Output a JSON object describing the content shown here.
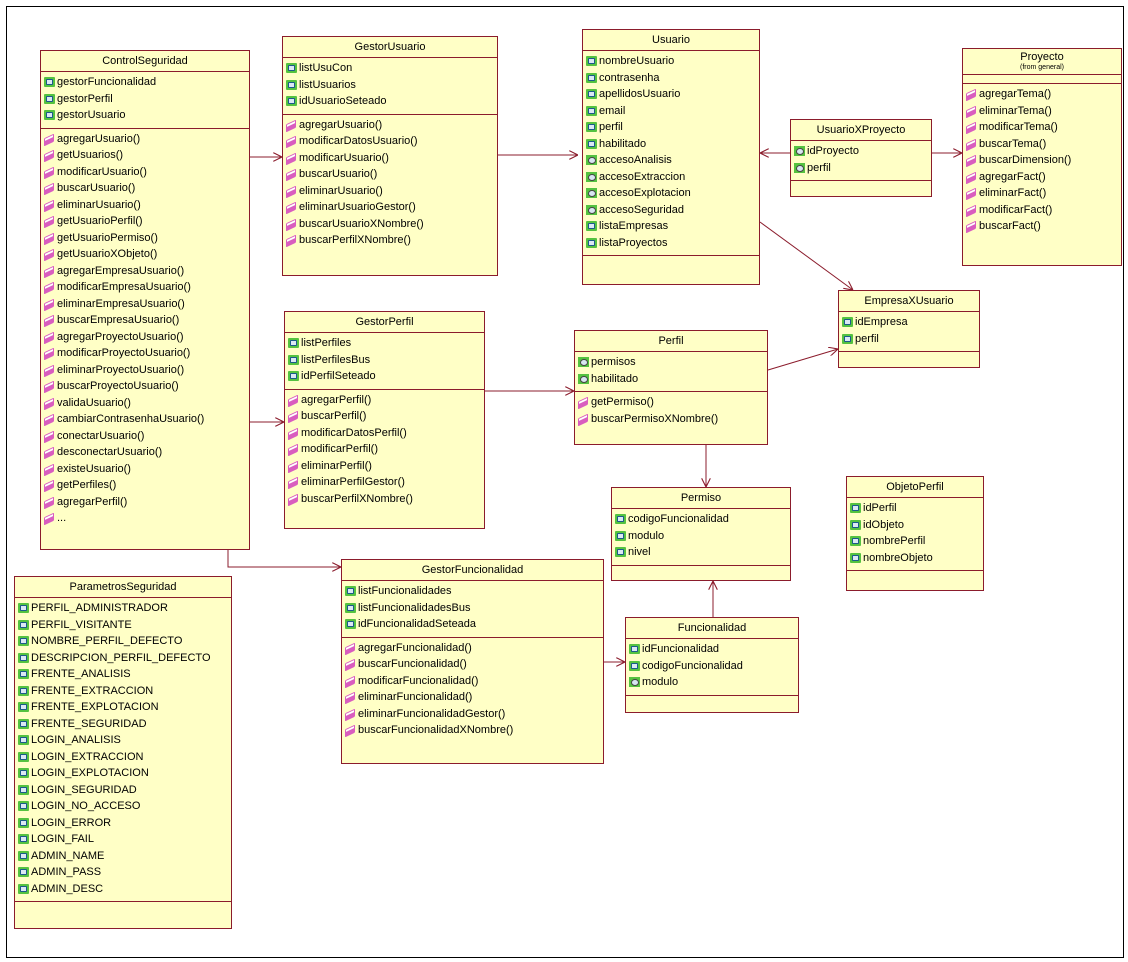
{
  "colors": {
    "class_fill": "#ffffc6",
    "class_border": "#8b1c2c",
    "attr_icon": "#55c240",
    "op_icon": "#d95dbf",
    "link": "#8b1c2c"
  },
  "classes": {
    "control_seguridad": {
      "name": "ControlSeguridad",
      "attributes": [
        "gestorFuncionalidad",
        "gestorPerfil",
        "gestorUsuario"
      ],
      "operations": [
        "agregarUsuario()",
        "getUsuarios()",
        "modificarUsuario()",
        "buscarUsuario()",
        "eliminarUsuario()",
        "getUsuarioPerfil()",
        "getUsuarioPermiso()",
        "getUsuarioXObjeto()",
        "agregarEmpresaUsuario()",
        "modificarEmpresaUsuario()",
        "eliminarEmpresaUsuario()",
        "buscarEmpresaUsuario()",
        "agregarProyectoUsuario()",
        "modificarProyectoUsuario()",
        "eliminarProyectoUsuario()",
        "buscarProyectoUsuario()",
        "validaUsuario()",
        "cambiarContrasenhaUsuario()",
        "conectarUsuario()",
        "desconectarUsuario()",
        "existeUsuario()",
        "getPerfiles()",
        "agregarPerfil()",
        "..."
      ]
    },
    "gestor_usuario": {
      "name": "GestorUsuario",
      "attributes": [
        "listUsuCon",
        "listUsuarios",
        "idUsuarioSeteado"
      ],
      "operations": [
        "agregarUsuario()",
        "modificarDatosUsuario()",
        "modificarUsuario()",
        "buscarUsuario()",
        "eliminarUsuario()",
        "eliminarUsuarioGestor()",
        "buscarUsuarioXNombre()",
        "buscarPerfilXNombre()"
      ]
    },
    "usuario": {
      "name": "Usuario",
      "attributes": [
        "nombreUsuario",
        "contrasenha",
        "apellidosUsuario",
        "email",
        "perfil",
        "habilitado",
        "accesoAnalisis",
        "accesoExtraccion",
        "accesoExplotacion",
        "accesoSeguridad",
        "listaEmpresas",
        "listaProyectos"
      ],
      "operations": []
    },
    "usuario_x_proyecto": {
      "name": "UsuarioXProyecto",
      "attributes": [
        "idProyecto",
        "perfil"
      ],
      "operations": []
    },
    "proyecto": {
      "name": "Proyecto",
      "stereotype": "(from general)",
      "attributes": [],
      "operations": [
        "agregarTema()",
        "eliminarTema()",
        "modificarTema()",
        "buscarTema()",
        "buscarDimension()",
        "agregarFact()",
        "eliminarFact()",
        "modificarFact()",
        "buscarFact()"
      ]
    },
    "empresa_x_usuario": {
      "name": "EmpresaXUsuario",
      "attributes": [
        "idEmpresa",
        "perfil"
      ],
      "operations": []
    },
    "gestor_perfil": {
      "name": "GestorPerfil",
      "attributes": [
        "listPerfiles",
        "listPerfilesBus",
        "idPerfilSeteado"
      ],
      "operations": [
        "agregarPerfil()",
        "buscarPerfil()",
        "modificarDatosPerfil()",
        "modificarPerfil()",
        "eliminarPerfil()",
        "eliminarPerfilGestor()",
        "buscarPerfilXNombre()"
      ]
    },
    "perfil": {
      "name": "Perfil",
      "attributes": [
        "permisos",
        "habilitado"
      ],
      "operations": [
        "getPermiso()",
        "buscarPermisoXNombre()"
      ]
    },
    "permiso": {
      "name": "Permiso",
      "attributes": [
        "codigoFuncionalidad",
        "modulo",
        "nivel"
      ],
      "operations": []
    },
    "objeto_perfil": {
      "name": "ObjetoPerfil",
      "attributes": [
        "idPerfil",
        "idObjeto",
        "nombrePerfil",
        "nombreObjeto"
      ],
      "operations": []
    },
    "parametros_seguridad": {
      "name": "ParametrosSeguridad",
      "attributes": [
        "PERFIL_ADMINISTRADOR",
        "PERFIL_VISITANTE",
        "NOMBRE_PERFIL_DEFECTO",
        "DESCRIPCION_PERFIL_DEFECTO",
        "FRENTE_ANALISIS",
        "FRENTE_EXTRACCION",
        "FRENTE_EXPLOTACION",
        "FRENTE_SEGURIDAD",
        "LOGIN_ANALISIS",
        "LOGIN_EXTRACCION",
        "LOGIN_EXPLOTACION",
        "LOGIN_SEGURIDAD",
        "LOGIN_NO_ACCESO",
        "LOGIN_ERROR",
        "LOGIN_FAIL",
        "ADMIN_NAME",
        "ADMIN_PASS",
        "ADMIN_DESC"
      ],
      "operations": []
    },
    "gestor_funcionalidad": {
      "name": "GestorFuncionalidad",
      "attributes": [
        "listFuncionalidades",
        "listFuncionalidadesBus",
        "idFuncionalidadSeteada"
      ],
      "operations": [
        "agregarFuncionalidad()",
        "buscarFuncionalidad()",
        "modificarFuncionalidad()",
        "eliminarFuncionalidad()",
        "eliminarFuncionalidadGestor()",
        "buscarFuncionalidadXNombre()"
      ]
    },
    "funcionalidad": {
      "name": "Funcionalidad",
      "attributes": [
        "idFuncionalidad",
        "codigoFuncionalidad",
        "modulo"
      ],
      "operations": []
    }
  }
}
